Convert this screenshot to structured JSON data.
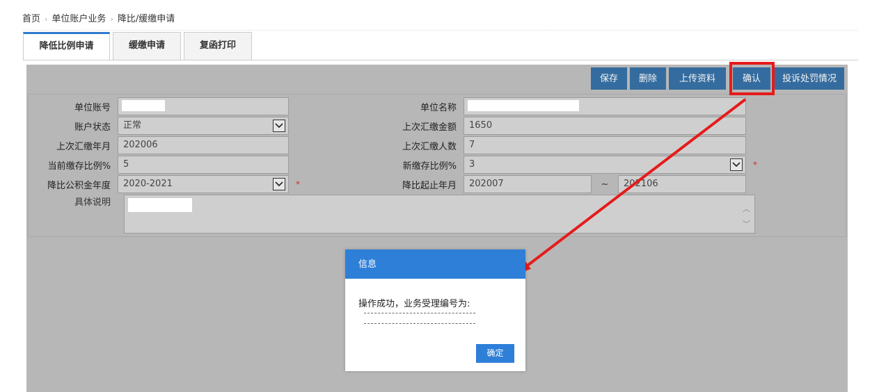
{
  "breadcrumb": {
    "home": "首页",
    "level2": "单位账户业务",
    "level3": "降比/缓缴申请"
  },
  "tabs": [
    {
      "label": "降低比例申请",
      "active": true
    },
    {
      "label": "缓缴申请",
      "active": false
    },
    {
      "label": "复函打印",
      "active": false
    }
  ],
  "toolbar": {
    "save": "保存",
    "delete": "删除",
    "upload": "上传资料",
    "confirm": "确认",
    "complaint": "投诉处罚情况"
  },
  "form": {
    "unit_account_label": "单位账号",
    "unit_name_label": "单位名称",
    "account_status_label": "账户状态",
    "account_status_value": "正常",
    "last_amount_label": "上次汇缴金额",
    "last_amount_value": "1650",
    "last_month_label": "上次汇缴年月",
    "last_month_value": "202006",
    "last_count_label": "上次汇缴人数",
    "last_count_value": "7",
    "current_ratio_label": "当前缴存比例%",
    "current_ratio_value": "5",
    "new_ratio_label": "新缴存比例%",
    "new_ratio_value": "3",
    "fund_year_label": "降比公积金年度",
    "fund_year_value": "2020-2021",
    "period_label": "降比起止年月",
    "period_start": "202007",
    "period_tilde": "~",
    "period_end": "202106",
    "desc_label": "具体说明",
    "required_mark": "*"
  },
  "dialog": {
    "title": "信息",
    "message": "操作成功，业务受理编号为:",
    "ok": "确定"
  },
  "colors": {
    "accent": "#2e7fd8",
    "toolbar_button": "#1f5f9b",
    "annotation": "#e51b1b"
  }
}
